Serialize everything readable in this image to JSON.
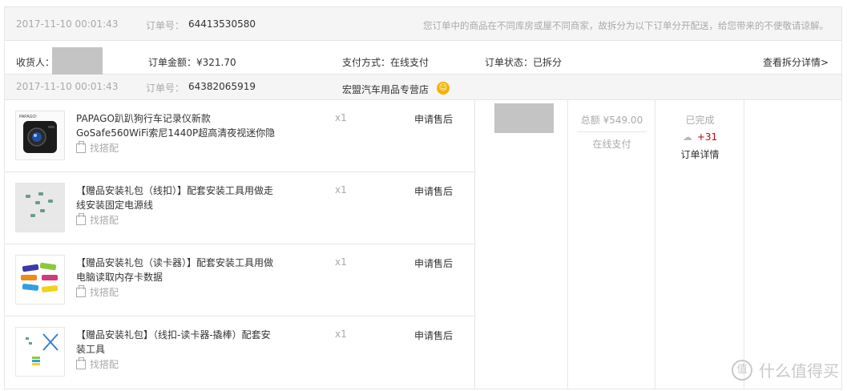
{
  "parent_order": {
    "date": "2017-11-10 00:01:43",
    "order_label": "订单号：",
    "order_number": "64413530580",
    "notice": "您订单中的商品在不同库房或屋不同商家，故拆分为以下订单分开配送，给您带来的不便敬请谅解。"
  },
  "summary": {
    "receiver_label": "收货人：",
    "amount": "订单金额：¥321.70",
    "payment": "支付方式：在线支付",
    "status": "订单状态：已拆分",
    "split_detail_link": "查看拆分详情>"
  },
  "sub_order": {
    "date": "2017-11-10 00:01:43",
    "order_label": "订单号：",
    "order_number": "64382065919",
    "store": "宏盟汽车用品专营店"
  },
  "items": [
    {
      "name": "PAPAGO趴趴狗行车记录仪新款GoSafe560WiFi索尼1440P超高清夜视迷你隐",
      "match": "找搭配",
      "qty": "x1",
      "action": "申请售后",
      "thumb_label": "PAPAGO!"
    },
    {
      "name": "【赠品安装礼包（线扣）】配套安装工具用做走线安装固定电源线",
      "match": "找搭配",
      "qty": "x1",
      "action": "申请售后"
    },
    {
      "name": "【赠品安装礼包（读卡器）】配套安装工具用做电脑读取内存卡数据",
      "match": "找搭配",
      "qty": "x1",
      "action": "申请售后"
    },
    {
      "name": "【赠品安装礼包】（线扣-读卡器-撬棒）配套安装工具",
      "match": "找搭配",
      "qty": "x1",
      "action": "申请售后"
    }
  ],
  "totals": {
    "amount": "总额 ¥549.00",
    "method": "在线支付"
  },
  "order_status": {
    "status": "已完成",
    "points": "+31",
    "detail_link": "订单详情"
  },
  "watermark": {
    "logo": "值",
    "text": "什么值得买"
  }
}
